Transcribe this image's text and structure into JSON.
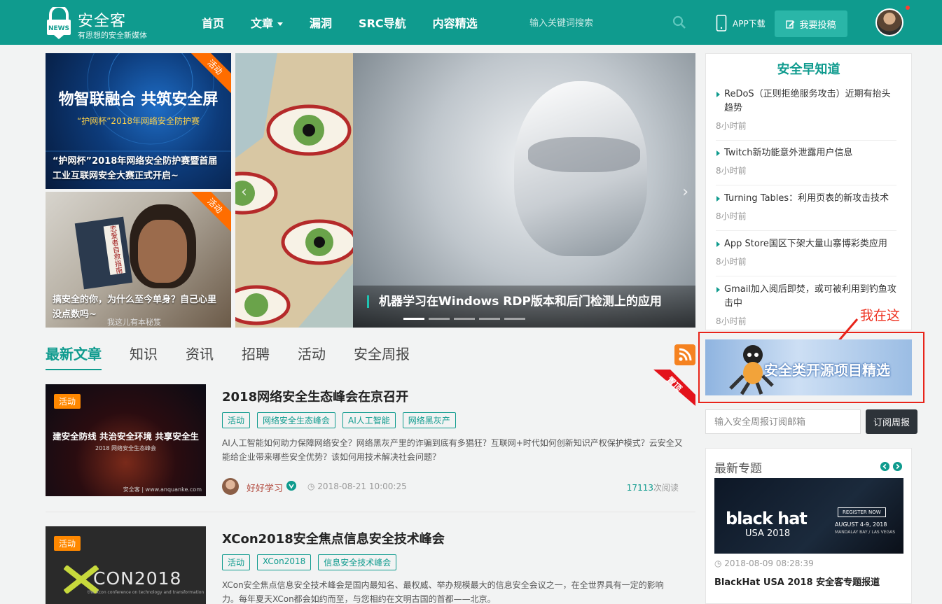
{
  "header": {
    "logo_title": "安全客",
    "logo_tagline": "有思想的安全新媒体",
    "logo_badge": "NEWS",
    "nav": [
      "首页",
      "文章",
      "漏洞",
      "SRC导航",
      "内容精选"
    ],
    "search_placeholder": "输入关键词搜索",
    "app_download": "APP下载",
    "contribute": "我要投稿"
  },
  "featured": {
    "small": [
      {
        "tag": "活动",
        "caption": "“护网杯”2018年网络安全防护赛暨首届工业互联网安全大赛正式开启~",
        "banner_text": "物智联融合 共筑安全屏",
        "banner_sub": "“护网杯”2018年网络安全防护赛"
      },
      {
        "tag": "活动",
        "caption": "搞安全的你，为什么至今单身？自己心里没点数吗~",
        "watermark": "我这儿有本秘笈",
        "book_text": "恋爱者自救指南"
      }
    ],
    "carousel_caption": "机器学习在Windows RDP版本和后门检测上的应用"
  },
  "tabs": [
    "最新文章",
    "知识",
    "资讯",
    "招聘",
    "活动",
    "安全周报"
  ],
  "ribbon": "置顶",
  "articles": [
    {
      "tag": "活动",
      "thumb_text": "建安全防线 共治安全环境 共享安全生",
      "thumb_sub": "2018 网络安全生态峰会",
      "thumb_credit": "安全客 | www.anquanke.com",
      "title": "2018网络安全生态峰会在京召开",
      "tags": [
        "活动",
        "网络安全生态峰会",
        "AI人工智能",
        "网络黑灰产"
      ],
      "desc": "AI人工智能如何助力保障网络安全？网络黑灰产里的诈骗到底有多猖狂？互联网+时代如何创新知识产权保护模式？云安全又能给企业带来哪些安全优势？该如何用技术解决社会问题？",
      "author": "好好学习",
      "date": "2018-08-21 10:00:25",
      "reads_count": "17113",
      "reads_suffix": "次阅读"
    },
    {
      "tag": "活动",
      "thumb_text": "CON2018",
      "thumb_sub": "the Xcon conference on technology and transformation",
      "title": "XCon2018安全焦点信息安全技术峰会",
      "tags": [
        "活动",
        "XCon2018",
        "信息安全技术峰会"
      ],
      "desc": "XCon安全焦点信息安全技术峰会是国内最知名、最权威、举办规模最大的信息安全会议之一，在全世界具有一定的影响力。每年夏天XCon都会如约而至，与您相约在文明古国的首都——北京。"
    }
  ],
  "sidebar": {
    "early_title": "安全早知道",
    "early_items": [
      {
        "title": "ReDoS（正则拒绝服务攻击）近期有抬头趋势",
        "time": "8小时前"
      },
      {
        "title": "Twitch新功能意外泄露用户信息",
        "time": "8小时前"
      },
      {
        "title": "Turning Tables：利用页表的新攻击技术",
        "time": "8小时前"
      },
      {
        "title": "App Store国区下架大量山寨博彩类应用",
        "time": "8小时前"
      },
      {
        "title": "Gmail加入阅后即焚，或可被利用到钓鱼攻击中",
        "time": "8小时前"
      }
    ],
    "annotation": "我在这",
    "promo": "安全类开源项目精选",
    "subscribe_placeholder": "输入安全周报订阅邮箱",
    "subscribe_button": "订阅周报",
    "topic_title": "最新专题",
    "topic_img_text": "black hat",
    "topic_img_sub": "USA 2018",
    "topic_img_register": "REGISTER NOW",
    "topic_img_date": "AUGUST 4-9, 2018",
    "topic_img_venue": "MANDALAY BAY / LAS VEGAS",
    "topic_date": "2018-08-09 08:28:39",
    "topic_name": "BlackHat USA 2018 安全客专题报道"
  },
  "colors": {
    "brand": "#0f9b8e",
    "accent": "#ff6d00",
    "annotation": "#e8241a"
  },
  "icons": [
    "shield-logo-icon",
    "search-icon",
    "phone-icon",
    "edit-icon",
    "rss-icon",
    "chevron-left-icon",
    "chevron-right-icon",
    "clock-icon",
    "verified-icon"
  ]
}
